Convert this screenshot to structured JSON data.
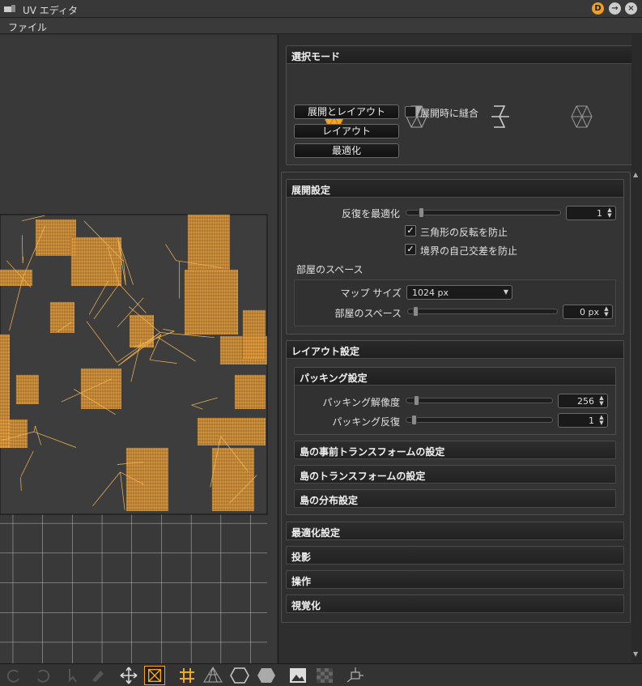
{
  "window": {
    "title": "UV エディタ",
    "buttons": [
      "D",
      "→",
      "×"
    ]
  },
  "menu": {
    "file": "ファイル"
  },
  "selection_mode": {
    "header": "選択モード",
    "modes": [
      "island-mode-icon",
      "vertex-mode-icon",
      "edge-mode-icon",
      "face-mode-icon"
    ],
    "unwrap_layout_button": "展開とレイアウト",
    "merge_on_unwrap_label": "展開時に縫合",
    "merge_on_unwrap_checked": false,
    "layout_button": "レイアウト",
    "optimize_button": "最適化"
  },
  "unwrap_settings": {
    "header": "展開設定",
    "iterations_label": "反復を最適化",
    "iterations_value": "1",
    "iterations_fraction": 0.05,
    "prevent_flip_label": "三角形の反転を防止",
    "prevent_flip_checked": true,
    "prevent_self_intersect_label": "境界の自己交差を防止",
    "prevent_self_intersect_checked": true,
    "room_space_group": "部屋のスペース",
    "map_size_label": "マップ サイズ",
    "map_size_value": "1024 px",
    "room_space_label": "部屋のスペース",
    "room_space_value": "0 px",
    "room_space_fraction": 0.0
  },
  "layout_settings": {
    "header": "レイアウト設定",
    "packing": {
      "header": "パッキング設定",
      "resolution_label": "パッキング解像度",
      "resolution_value": "256",
      "resolution_fraction": 0.02,
      "iterations_label": "パッキング反復",
      "iterations_value": "1",
      "iterations_fraction": 0.0
    },
    "island_pre_transform": "島の事前トランスフォームの設定",
    "island_transform": "島のトランスフォームの設定",
    "island_distribution": "島の分布設定"
  },
  "sections": [
    "最適化設定",
    "投影",
    "操作",
    "視覚化"
  ],
  "colors": {
    "accent": "#f5a623",
    "uv_fill": "#f2a640",
    "uv_wire": "#f7b955",
    "grid": "#b0b0b0"
  },
  "toolbar_icons": [
    "rotate-left-icon",
    "rotate-right-icon",
    "select-icon",
    "paint-icon",
    "move-icon",
    "fit-icon",
    "grid-icon",
    "checker-icon",
    "island-outline-icon",
    "island-fill-icon",
    "image-icon",
    "checkerboard-icon",
    "transform-icon"
  ]
}
